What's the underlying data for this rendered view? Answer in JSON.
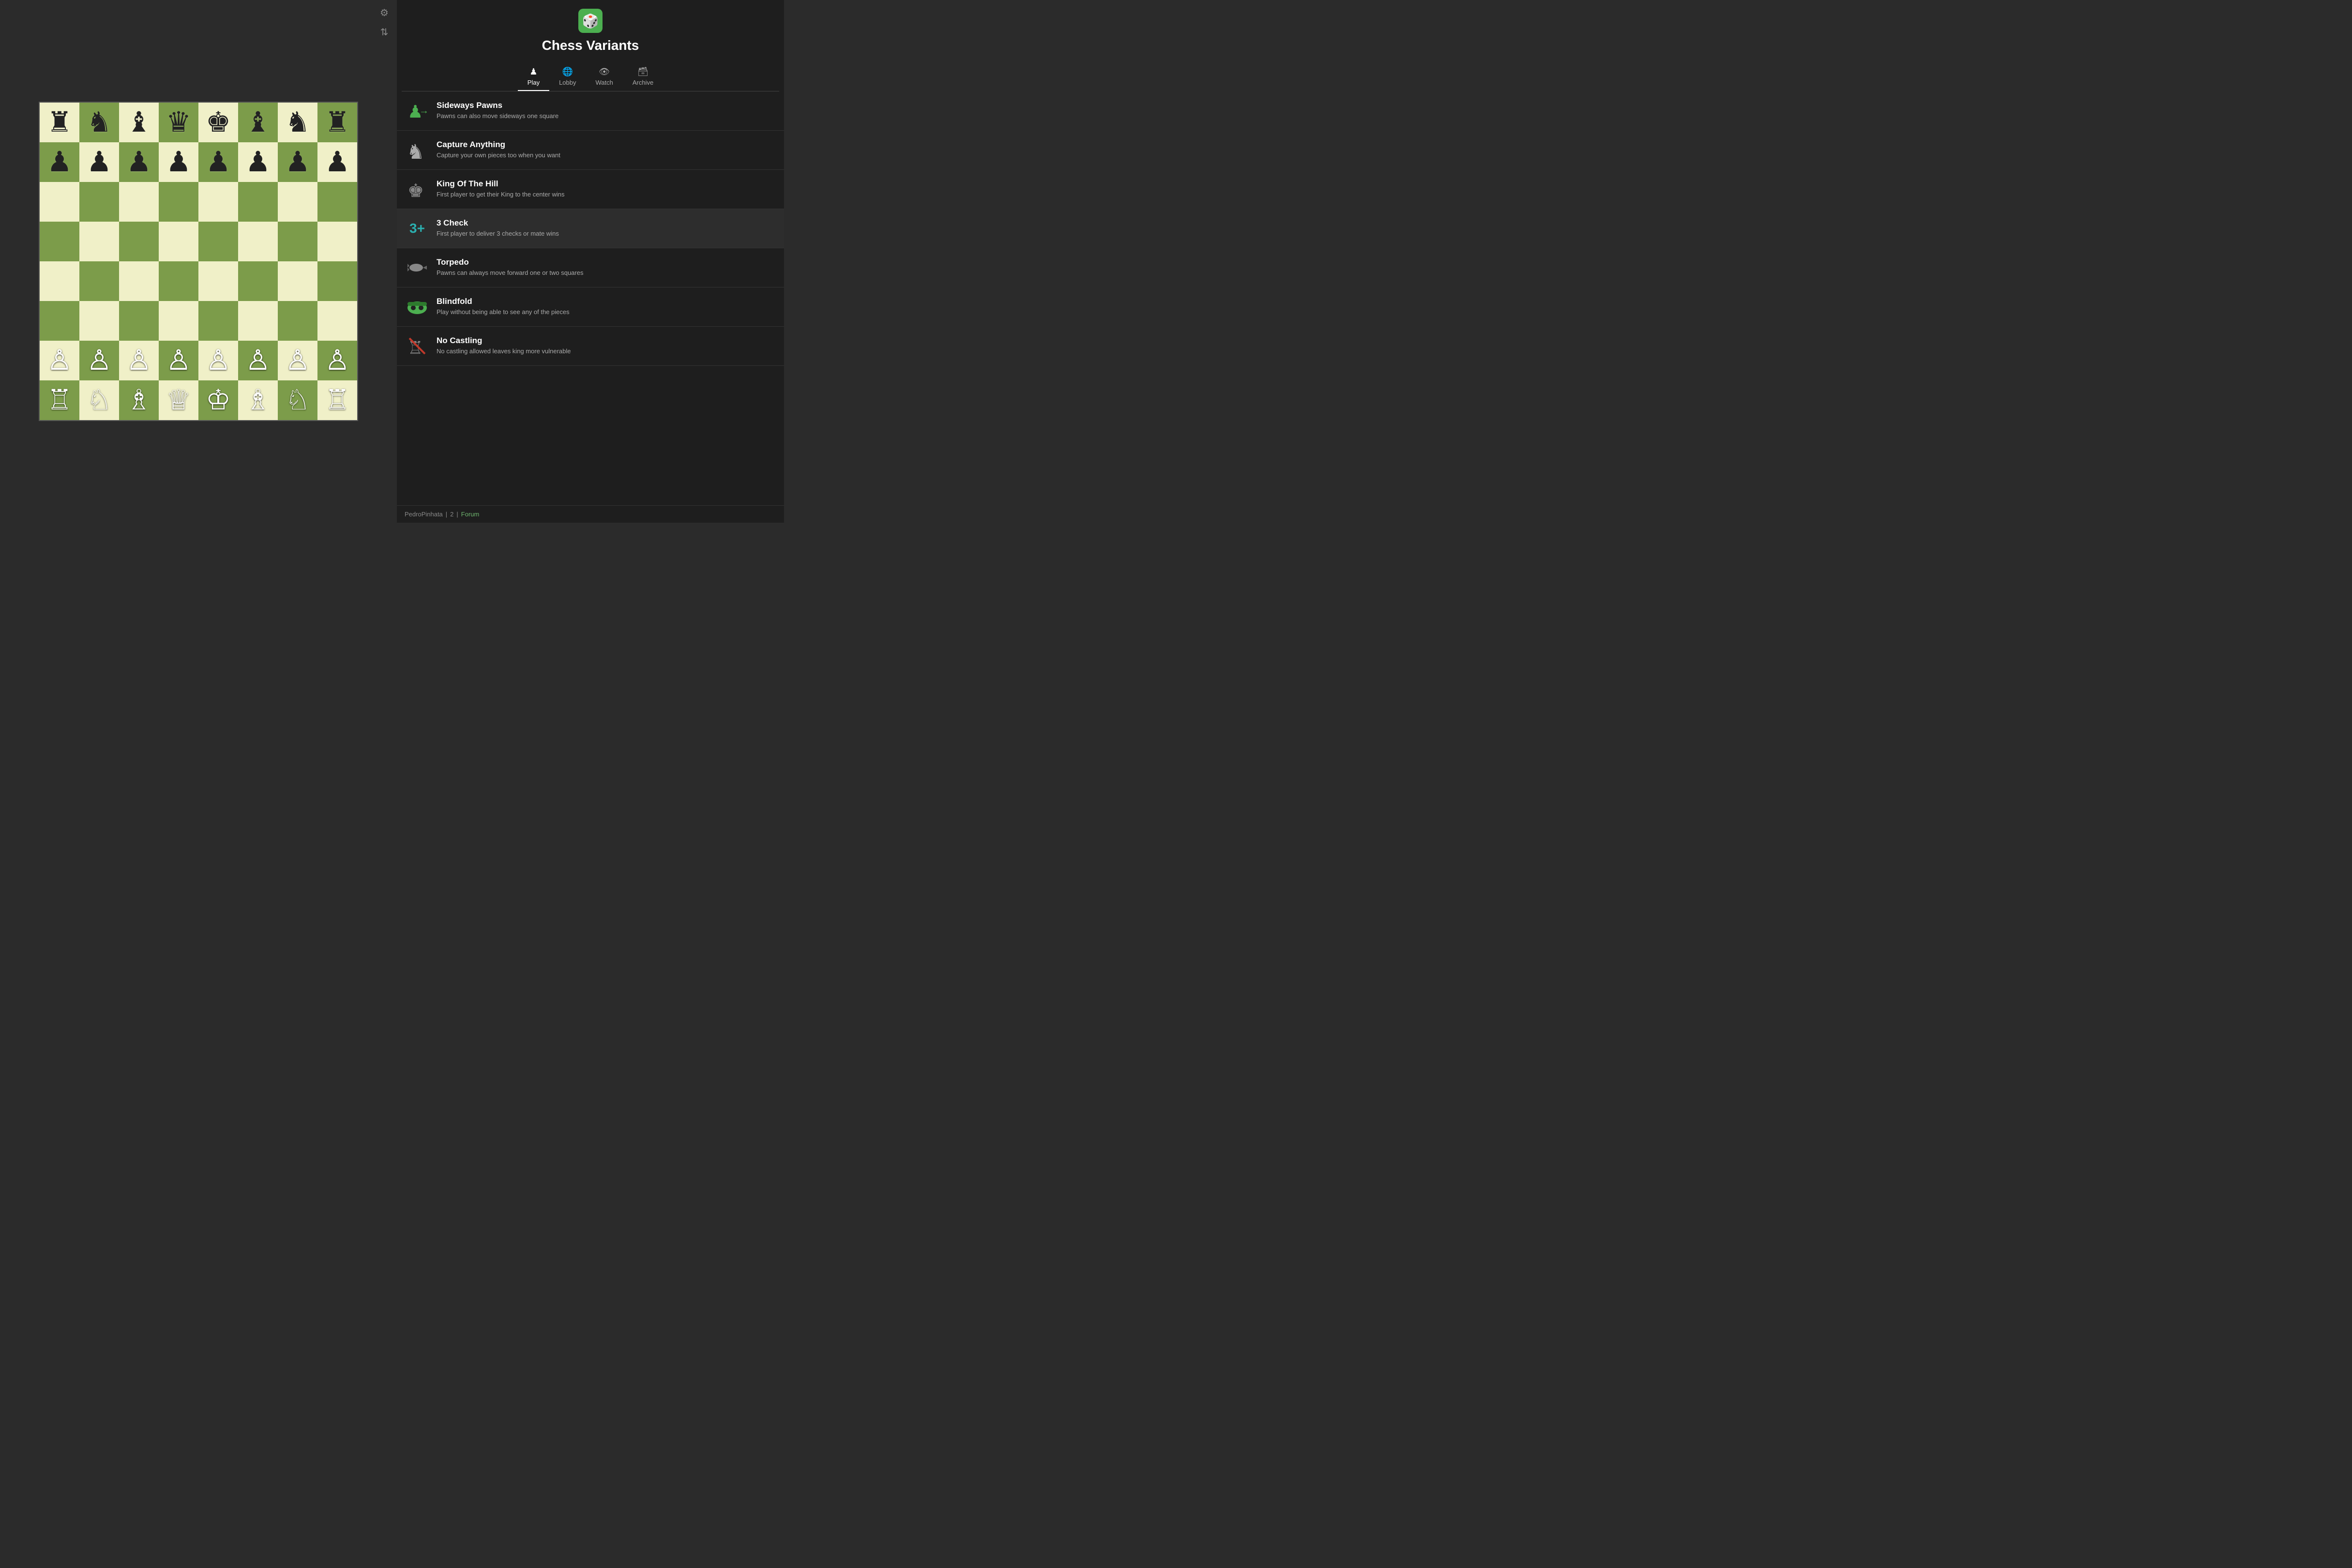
{
  "topIcons": [
    {
      "name": "gear-icon",
      "symbol": "⚙"
    },
    {
      "name": "swap-icon",
      "symbol": "⇅"
    }
  ],
  "panel": {
    "title": "Chess Variants",
    "diceSymbol": "🎲"
  },
  "navTabs": [
    {
      "id": "play",
      "label": "Play",
      "icon": "♟",
      "active": true
    },
    {
      "id": "lobby",
      "label": "Lobby",
      "icon": "🌐",
      "active": false
    },
    {
      "id": "watch",
      "label": "Watch",
      "icon": "👁",
      "active": false
    },
    {
      "id": "archive",
      "label": "Archive",
      "icon": "🗃",
      "active": false
    }
  ],
  "variants": [
    {
      "id": "sideways-pawns",
      "name": "Sideways Pawns",
      "desc": "Pawns can also move sideways one square",
      "icon": "→",
      "iconColor": "#4caf50",
      "active": false
    },
    {
      "id": "capture-anything",
      "name": "Capture Anything",
      "desc": "Capture your own pieces too when you want",
      "icon": "♞",
      "iconColor": "#aaa",
      "active": false
    },
    {
      "id": "king-of-the-hill",
      "name": "King Of The Hill",
      "desc": "First player to get their King to the center wins",
      "icon": "♚",
      "iconColor": "#888",
      "active": false
    },
    {
      "id": "3-check",
      "name": "3 Check",
      "desc": "First player to deliver 3 checks or mate wins",
      "icon": "3+",
      "iconColor": "#2bb0b0",
      "active": true
    },
    {
      "id": "torpedo",
      "name": "Torpedo",
      "desc": "Pawns can always move forward one or two squares",
      "icon": "💣",
      "iconColor": "#ccc",
      "active": false
    },
    {
      "id": "blindfold",
      "name": "Blindfold",
      "desc": "Play without being able to see any of the pieces",
      "icon": "🥽",
      "iconColor": "#4caf50",
      "active": false
    },
    {
      "id": "no-castling",
      "name": "No Castling",
      "desc": "No castling allowed leaves king more vulnerable",
      "icon": "🏰",
      "iconColor": "#888",
      "active": false
    }
  ],
  "footer": {
    "username": "PedroPinhata",
    "separator": "|",
    "rating": "2",
    "forumLabel": "Forum"
  },
  "board": {
    "pieces": [
      [
        "♜",
        "♞",
        "♝",
        "♛",
        "♚",
        "♝",
        "♞",
        "♜"
      ],
      [
        "♟",
        "♟",
        "♟",
        "♟",
        "♟",
        "♟",
        "♟",
        "♟"
      ],
      [
        "",
        "",
        "",
        "",
        "",
        "",
        "",
        ""
      ],
      [
        "",
        "",
        "",
        "",
        "",
        "",
        "",
        ""
      ],
      [
        "",
        "",
        "",
        "",
        "",
        "",
        "",
        ""
      ],
      [
        "",
        "",
        "",
        "",
        "",
        "",
        "",
        ""
      ],
      [
        "♙",
        "♙",
        "♙",
        "♙",
        "♙",
        "♙",
        "♙",
        "♙"
      ],
      [
        "♖",
        "♘",
        "♗",
        "♕",
        "♔",
        "♗",
        "♘",
        "♖"
      ]
    ]
  }
}
